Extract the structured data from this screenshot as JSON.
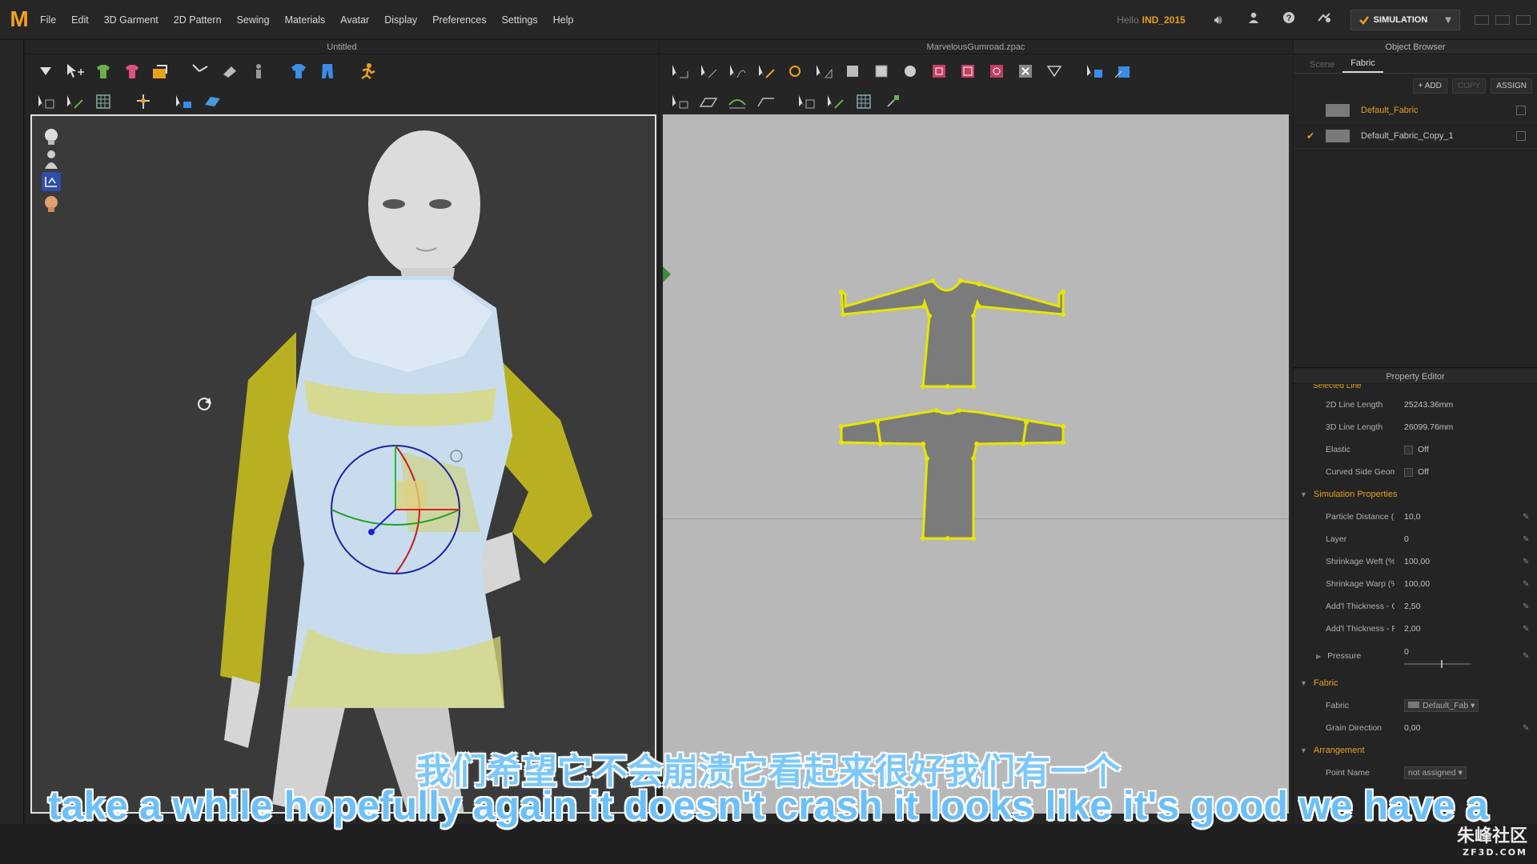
{
  "app": {
    "logo": "M",
    "menu": [
      "File",
      "Edit",
      "3D Garment",
      "2D Pattern",
      "Sewing",
      "Materials",
      "Avatar",
      "Display",
      "Preferences",
      "Settings",
      "Help"
    ],
    "hello": "Hello",
    "username": "IND_2015",
    "mode": "SIMULATION"
  },
  "panel3d": {
    "title": "Untitled"
  },
  "panel2d": {
    "title": "MarvelousGumroad.zpac"
  },
  "object_browser": {
    "title": "Object Browser",
    "tabs": [
      "Scene",
      "Fabric"
    ],
    "active_tab": "Fabric",
    "actions": {
      "add": "+ ADD",
      "copy": "COPY",
      "assign": "ASSIGN"
    },
    "fabrics": [
      {
        "name": "Default_Fabric",
        "checked": false,
        "selected": true
      },
      {
        "name": "Default_Fabric_Copy_1",
        "checked": true,
        "selected": false
      }
    ]
  },
  "property_editor": {
    "title": "Property Editor",
    "header_partial": "Selected Line",
    "line_props": [
      {
        "label": "2D Line Length",
        "value": "25243.36mm"
      },
      {
        "label": "3D Line Length",
        "value": "26099.76mm"
      },
      {
        "label": "Elastic",
        "value": "Off"
      },
      {
        "label": "Curved Side Geome",
        "value": "Off"
      }
    ],
    "simulation_section": "Simulation Properties",
    "simulation": [
      {
        "label": "Particle Distance (m",
        "value": "10,0"
      },
      {
        "label": "Layer",
        "value": "0"
      },
      {
        "label": "Shrinkage Weft (%",
        "value": "100,00"
      },
      {
        "label": "Shrinkage Warp (%",
        "value": "100,00"
      },
      {
        "label": "Add'l Thickness - Collisio",
        "value": "2,50"
      },
      {
        "label": "Add'l Thickness - Renderi",
        "value": "2,00"
      },
      {
        "label": "Pressure",
        "value": "0"
      }
    ],
    "fabric_section": "Fabric",
    "fabric": [
      {
        "label": "Fabric",
        "value": "Default_Fab"
      },
      {
        "label": "Grain Direction",
        "value": "0,00"
      }
    ],
    "arrangement_section": "Arrangement",
    "arrangement": [
      {
        "label": "Point Name",
        "value": "not assigned"
      }
    ]
  },
  "subtitles": {
    "chinese": "我们希望它不会崩溃它看起来很好我们有一个",
    "english": "take a while hopefully again it doesn't crash it looks like it's good we have a"
  },
  "watermark": {
    "main": "朱峰社区",
    "sub": "ZF3D.COM"
  },
  "colors": {
    "accent": "#e8a020",
    "selection_yellow": "#e6e600",
    "sleeve_yellow": "#b8b020",
    "subtitle_blue": "#6cc0f8"
  }
}
